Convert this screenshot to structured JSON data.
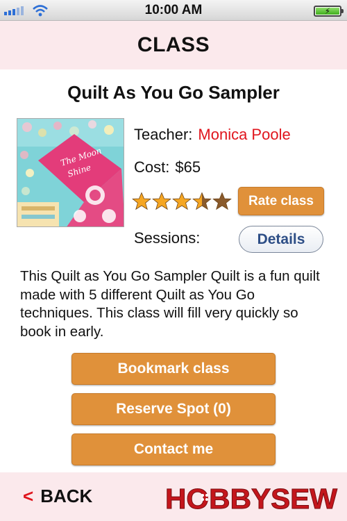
{
  "status_bar": {
    "time": "10:00 AM"
  },
  "header": {
    "title": "CLASS"
  },
  "class": {
    "title": "Quilt As You Go Sampler",
    "teacher_label": "Teacher:",
    "teacher_name": "Monica Poole",
    "cost_label": "Cost:",
    "cost_value": "$65",
    "rating": 3.5,
    "rating_max": 5,
    "sessions_label": "Sessions:",
    "description": "This Quilt as You Go Sampler Quilt is a fun quilt made with 5 different Quilt as You Go techniques. This class will fill very quickly so book in early.",
    "thumbnail_text": "Moon Shine"
  },
  "buttons": {
    "rate": "Rate class",
    "details": "Details",
    "bookmark": "Bookmark class",
    "reserve": "Reserve Spot (0)",
    "contact": "Contact me"
  },
  "footer": {
    "back_chevron": "<",
    "back_label": "BACK",
    "logo_text": "HOBBYSEW"
  },
  "colors": {
    "accent_orange": "#e0913a",
    "teacher_red": "#e0151d",
    "header_pink": "#fbe9ec",
    "logo_red": "#c4161c"
  },
  "icons": [
    "signal-icon",
    "wifi-icon",
    "battery-charging-icon",
    "star-icon"
  ]
}
